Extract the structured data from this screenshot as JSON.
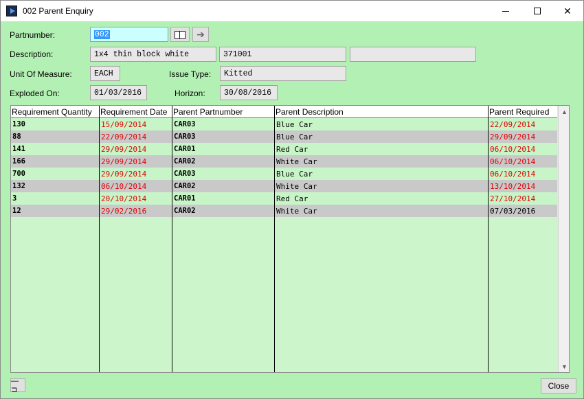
{
  "window": {
    "title": "002 Parent Enquiry"
  },
  "form": {
    "partnumber_label": "Partnumber:",
    "partnumber_value": "002",
    "description_label": "Description:",
    "description_value": "1x4 thin block white",
    "description_code": "371001",
    "description_extra": "",
    "uom_label": "Unit Of Measure:",
    "uom_value": "EACH",
    "issue_type_label": "Issue Type:",
    "issue_type_value": "Kitted",
    "exploded_label": "Exploded On:",
    "exploded_value": "01/03/2016",
    "horizon_label": "Horizon:",
    "horizon_value": "30/08/2016"
  },
  "grid": {
    "columns": [
      "Requirement Quantity",
      "Requirement Date",
      "Parent Partnumber",
      "Parent Description",
      "Parent Required"
    ],
    "rows": [
      {
        "qty": "130",
        "req_date": "15/09/2014",
        "parent_pn": "CAR03",
        "parent_desc": "Blue Car",
        "parent_req": "22/09/2014"
      },
      {
        "qty": "88",
        "req_date": "22/09/2014",
        "parent_pn": "CAR03",
        "parent_desc": "Blue Car",
        "parent_req": "29/09/2014"
      },
      {
        "qty": "141",
        "req_date": "29/09/2014",
        "parent_pn": "CAR01",
        "parent_desc": "Red Car",
        "parent_req": "06/10/2014"
      },
      {
        "qty": "166",
        "req_date": "29/09/2014",
        "parent_pn": "CAR02",
        "parent_desc": "White Car",
        "parent_req": "06/10/2014"
      },
      {
        "qty": "700",
        "req_date": "29/09/2014",
        "parent_pn": "CAR03",
        "parent_desc": "Blue Car",
        "parent_req": "06/10/2014"
      },
      {
        "qty": "132",
        "req_date": "06/10/2014",
        "parent_pn": "CAR02",
        "parent_desc": "White Car",
        "parent_req": "13/10/2014"
      },
      {
        "qty": "3",
        "req_date": "20/10/2014",
        "parent_pn": "CAR01",
        "parent_desc": "Red Car",
        "parent_req": "27/10/2014"
      },
      {
        "qty": "12",
        "req_date": "29/02/2016",
        "parent_pn": "CAR02",
        "parent_desc": "White Car",
        "parent_req": "07/03/2016"
      }
    ]
  },
  "footer": {
    "close_label": "Close"
  },
  "colors": {
    "background": "#b3f0b3",
    "row_alt": "#c9c9c9",
    "row_normal": "#c8f5c8",
    "late_date": "#e00000",
    "editable_field": "#ccffff"
  }
}
